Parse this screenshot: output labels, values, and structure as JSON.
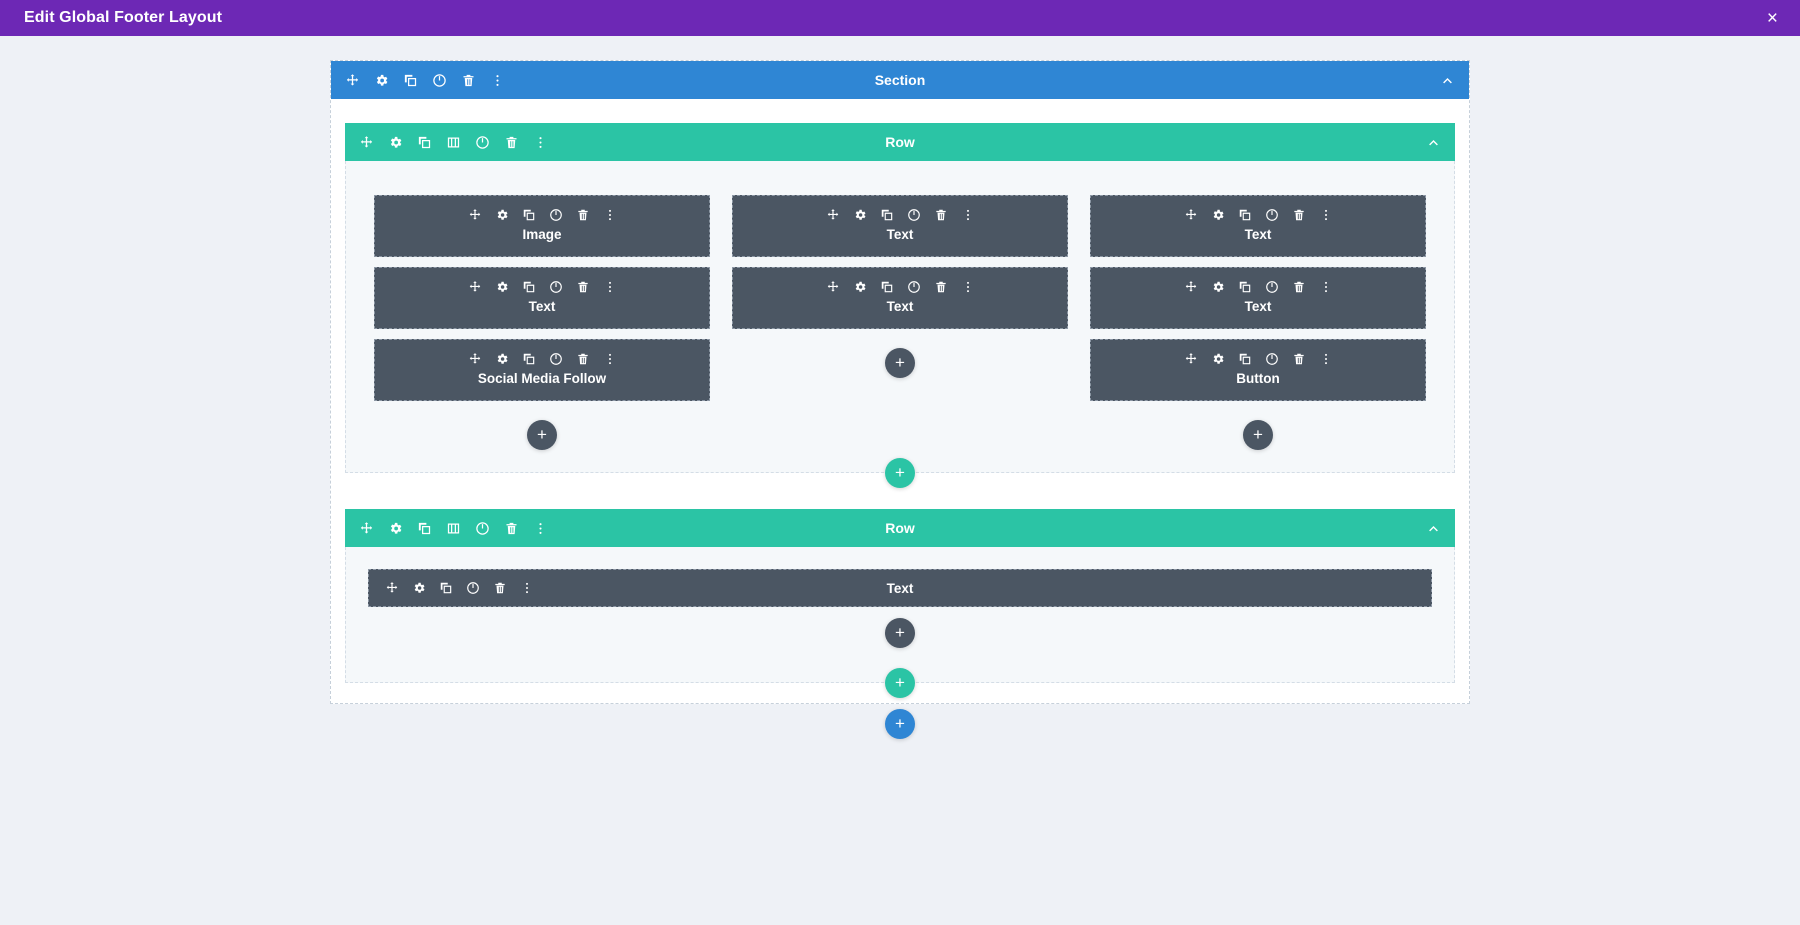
{
  "titlebar": {
    "title": "Edit Global Footer Layout",
    "close_label": "×",
    "background": "#6d28b5"
  },
  "colors": {
    "section": "#2f86d4",
    "row": "#2bc4a5",
    "module": "#4b5663",
    "page_background": "#eef1f6",
    "row_background": "#f5f8fa"
  },
  "icons": {
    "move": "move-icon",
    "settings": "gear-icon",
    "duplicate": "duplicate-icon",
    "columns": "columns-icon",
    "toggle": "power-toggle-icon",
    "delete": "trash-icon",
    "more": "kebab-menu-icon",
    "collapse": "chevron-up-icon",
    "add": "plus-icon"
  },
  "add_labels": {
    "module": "+",
    "row": "+",
    "section": "+"
  },
  "section": {
    "label": "Section",
    "rows": [
      {
        "label": "Row",
        "columns": [
          {
            "modules": [
              {
                "label": "Image"
              },
              {
                "label": "Text"
              },
              {
                "label": "Social Media Follow"
              }
            ]
          },
          {
            "modules": [
              {
                "label": "Text"
              },
              {
                "label": "Text"
              }
            ]
          },
          {
            "modules": [
              {
                "label": "Text"
              },
              {
                "label": "Text"
              },
              {
                "label": "Button"
              }
            ]
          }
        ]
      },
      {
        "label": "Row",
        "columns": [
          {
            "modules": [
              {
                "label": "Text"
              }
            ]
          }
        ]
      }
    ]
  }
}
